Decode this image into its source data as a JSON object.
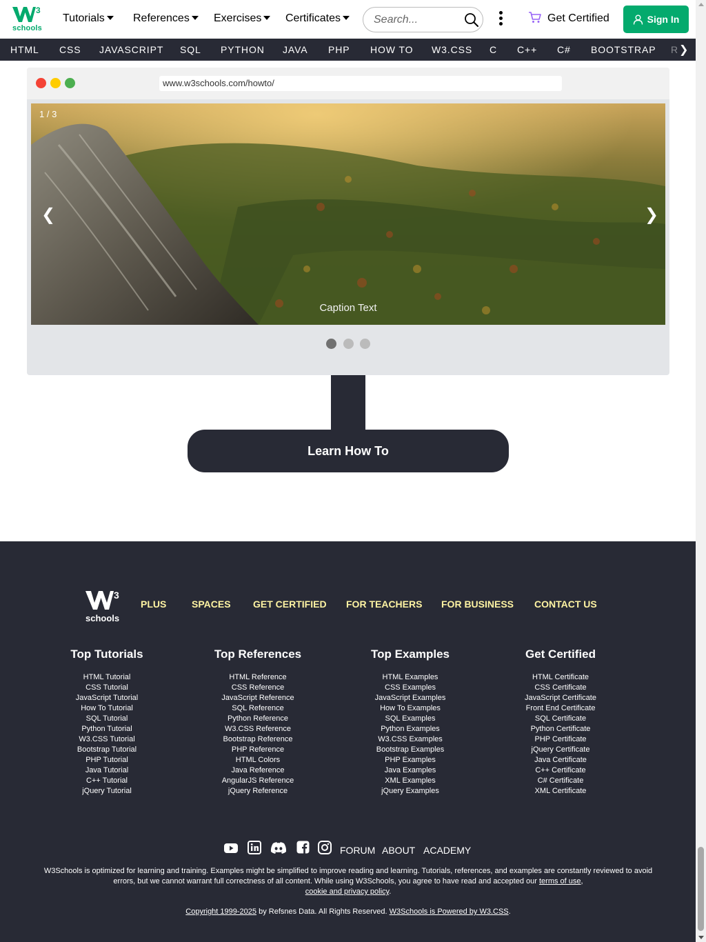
{
  "header": {
    "logo_text": "schools",
    "menu": [
      {
        "label": "Tutorials"
      },
      {
        "label": "References"
      },
      {
        "label": "Exercises"
      },
      {
        "label": "Certificates"
      }
    ],
    "search_placeholder": "Search...",
    "get_certified": "Get Certified",
    "sign_in": "Sign In",
    "accent_color": "#04AA6D"
  },
  "subjects": [
    "HTML",
    "CSS",
    "JAVASCRIPT",
    "SQL",
    "PYTHON",
    "JAVA",
    "PHP",
    "HOW TO",
    "W3.CSS",
    "C",
    "C++",
    "C#",
    "BOOTSTRAP",
    "R"
  ],
  "mockup": {
    "url": "www.w3schools.com/howto/",
    "slideshow": {
      "counter": "1 / 3",
      "prev": "❮",
      "next": "❯",
      "caption": "Caption Text",
      "total_slides": 3,
      "active_slide": 1
    }
  },
  "learn_button": "Learn How To",
  "footer": {
    "logo_text": "schools",
    "links": [
      "PLUS",
      "SPACES",
      "GET CERTIFIED",
      "FOR TEACHERS",
      "FOR BUSINESS",
      "CONTACT US"
    ],
    "link_color": "#FFF4A3",
    "columns": [
      {
        "title": "Top Tutorials",
        "items": [
          "HTML Tutorial",
          "CSS Tutorial",
          "JavaScript Tutorial",
          "How To Tutorial",
          "SQL Tutorial",
          "Python Tutorial",
          "W3.CSS Tutorial",
          "Bootstrap Tutorial",
          "PHP Tutorial",
          "Java Tutorial",
          "C++ Tutorial",
          "jQuery Tutorial"
        ]
      },
      {
        "title": "Top References",
        "items": [
          "HTML Reference",
          "CSS Reference",
          "JavaScript Reference",
          "SQL Reference",
          "Python Reference",
          "W3.CSS Reference",
          "Bootstrap Reference",
          "PHP Reference",
          "HTML Colors",
          "Java Reference",
          "AngularJS Reference",
          "jQuery Reference"
        ]
      },
      {
        "title": "Top Examples",
        "items": [
          "HTML Examples",
          "CSS Examples",
          "JavaScript Examples",
          "How To Examples",
          "SQL Examples",
          "Python Examples",
          "W3.CSS Examples",
          "Bootstrap Examples",
          "PHP Examples",
          "Java Examples",
          "XML Examples",
          "jQuery Examples"
        ]
      },
      {
        "title": "Get Certified",
        "items": [
          "HTML Certificate",
          "CSS Certificate",
          "JavaScript Certificate",
          "Front End Certificate",
          "SQL Certificate",
          "Python Certificate",
          "PHP Certificate",
          "jQuery Certificate",
          "Java Certificate",
          "C++ Certificate",
          "C# Certificate",
          "XML Certificate"
        ]
      }
    ],
    "social_icons": [
      "youtube-icon",
      "linkedin-icon",
      "discord-icon",
      "facebook-icon",
      "instagram-icon"
    ],
    "forum": "FORUM",
    "about": "ABOUT",
    "academy": "ACADEMY",
    "disclaimer_text": "W3Schools is optimized for learning and training. Examples might be simplified to improve reading and learning. Tutorials, references, and examples are constantly reviewed to avoid errors, but we cannot warrant full correctness of all content. While using W3Schools, you agree to have read and accepted our ",
    "terms_link": "terms of use",
    "comma": ",",
    "privacy_link": "cookie and privacy policy",
    "period": ".",
    "copyright_link": "Copyright 1999-2025",
    "copyright_text": " by Refsnes Data. All Rights Reserved. ",
    "powered_link": "W3Schools is Powered by W3.CSS",
    "powered_period": "."
  }
}
